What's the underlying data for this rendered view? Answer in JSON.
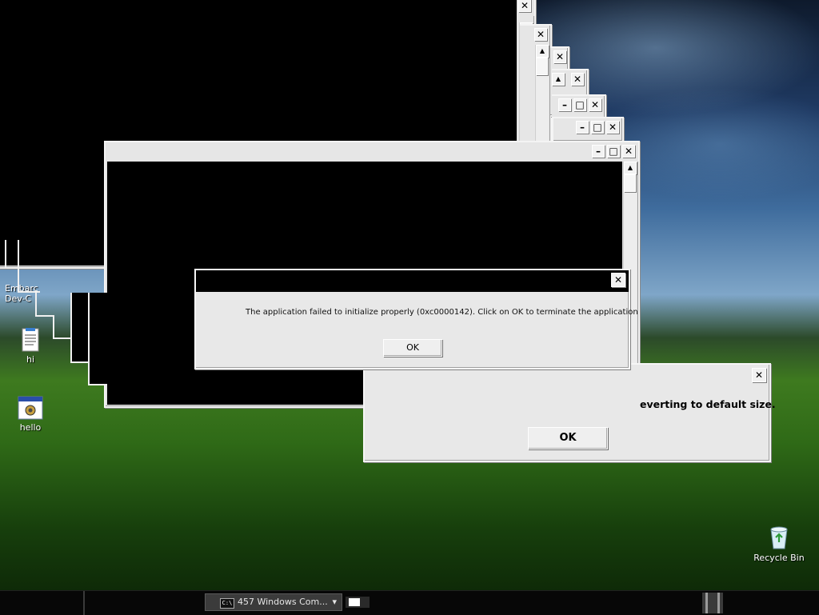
{
  "desktop": {
    "icons": [
      {
        "label": "Embarc\nDev-C",
        "name": "embarcadero-devcpp-icon"
      },
      {
        "label": "hi",
        "name": "text-file-icon"
      },
      {
        "label": "hello",
        "name": "application-exe-icon"
      },
      {
        "label": "Recycle Bin",
        "name": "recycle-bin-icon"
      }
    ]
  },
  "error_dialog": {
    "message": "The application failed to initialize properly (0xc0000142). Click on OK to terminate the application",
    "ok_label": "OK",
    "close_glyph": "✕"
  },
  "size_dialog": {
    "message_partial": "everting to default size.",
    "ok_label": "OK",
    "close_glyph": "✕"
  },
  "controls": {
    "minimize_glyph": "–",
    "maximize_glyph": "□",
    "close_glyph": "✕",
    "scroll_up_glyph": "▲",
    "scroll_down_glyph": "▼"
  },
  "taskbar": {
    "group_button_label": "457 Windows Com...",
    "group_icon_label": "C:\\",
    "dropdown_glyph": "▾"
  }
}
